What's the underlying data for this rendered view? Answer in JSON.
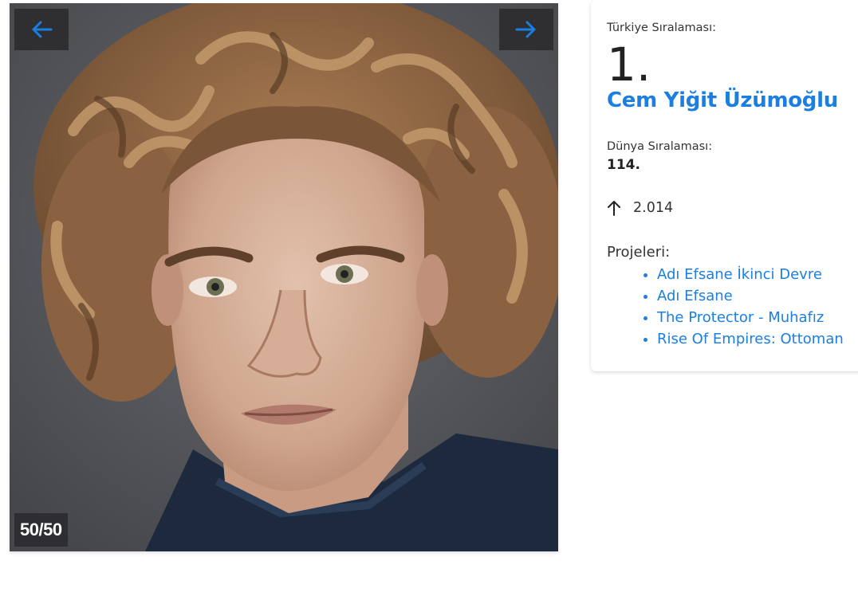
{
  "gallery": {
    "counter": "50/50",
    "prev_icon": "arrow-left-icon",
    "next_icon": "arrow-right-icon",
    "accent": "#1a7fe0"
  },
  "profile": {
    "turkey_rank_label": "Türkiye Sıralaması:",
    "turkey_rank": "1.",
    "name": "Cem Yiğit Üzümoğlu",
    "world_rank_label": "Dünya Sıralaması:",
    "world_rank": "114.",
    "trend_icon": "arrow-up-icon",
    "trend_value": "2.014",
    "projects_label": "Projeleri:",
    "projects": [
      "Adı Efsane İkinci Devre",
      "Adı Efsane",
      "The Protector - Muhafız",
      "Rise Of Empires: Ottoman"
    ]
  }
}
